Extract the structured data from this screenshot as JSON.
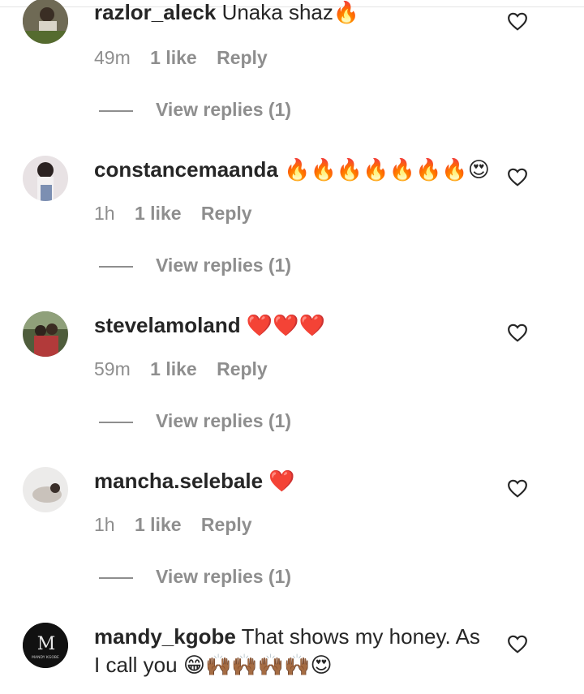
{
  "comments": [
    {
      "username": "razlor_aleck",
      "text": "Unaka shaz",
      "emoji": "🔥",
      "time": "49m",
      "likes": "1 like",
      "reply": "Reply",
      "view_replies": "View replies (1)"
    },
    {
      "username": "constancemaanda",
      "text": "",
      "emoji": "🔥🔥🔥🔥🔥🔥🔥😍",
      "time": "1h",
      "likes": "1 like",
      "reply": "Reply",
      "view_replies": "View replies (1)"
    },
    {
      "username": "stevelamoland",
      "text": "",
      "emoji": "❤️❤️❤️",
      "time": "59m",
      "likes": "1 like",
      "reply": "Reply",
      "view_replies": "View replies (1)"
    },
    {
      "username": "mancha.selebale",
      "text": "",
      "emoji": "❤️",
      "time": "1h",
      "likes": "1 like",
      "reply": "Reply",
      "view_replies": "View replies (1)"
    },
    {
      "username": "mandy_kgobe",
      "text": "That shows my honey. As I call you",
      "emoji": "😁🙌🏾🙌🏾🙌🏾🙌🏾😍",
      "avatar_text": "MANDY KGOBE",
      "avatar_letter": "M"
    }
  ],
  "icons": {
    "like": "heart-outline-icon"
  },
  "colors": {
    "text": "#262626",
    "secondary": "#8e8e8e",
    "background": "#ffffff"
  }
}
